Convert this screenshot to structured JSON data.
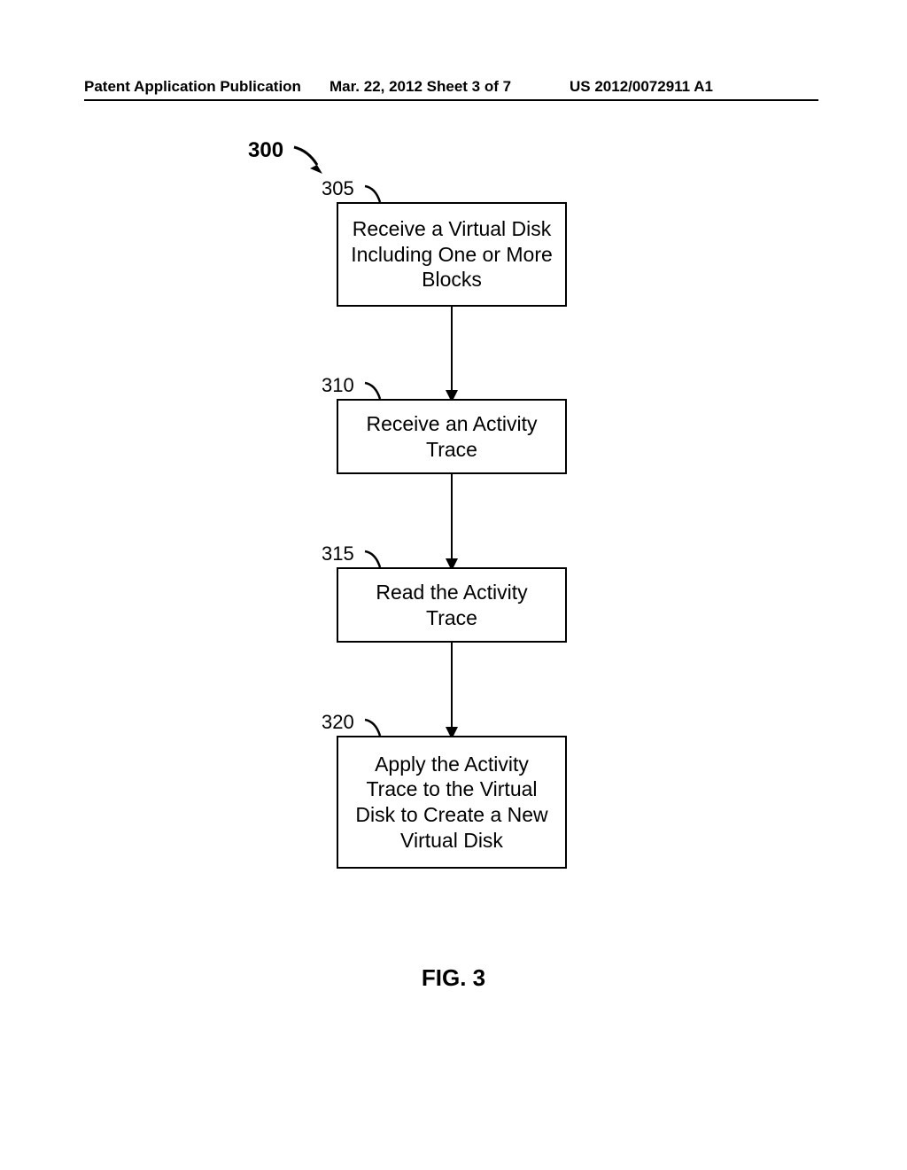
{
  "header": {
    "left": "Patent Application Publication",
    "center": "Mar. 22, 2012  Sheet 3 of 7",
    "right": "US 2012/0072911 A1"
  },
  "flowchart": {
    "main_ref": "300",
    "steps": [
      {
        "ref": "305",
        "text": "Receive a Virtual Disk Including One or More Blocks"
      },
      {
        "ref": "310",
        "text": "Receive an Activity Trace"
      },
      {
        "ref": "315",
        "text": "Read the Activity Trace"
      },
      {
        "ref": "320",
        "text": "Apply the Activity Trace to the Virtual Disk to Create a New Virtual Disk"
      }
    ]
  },
  "figure_label": "FIG. 3"
}
